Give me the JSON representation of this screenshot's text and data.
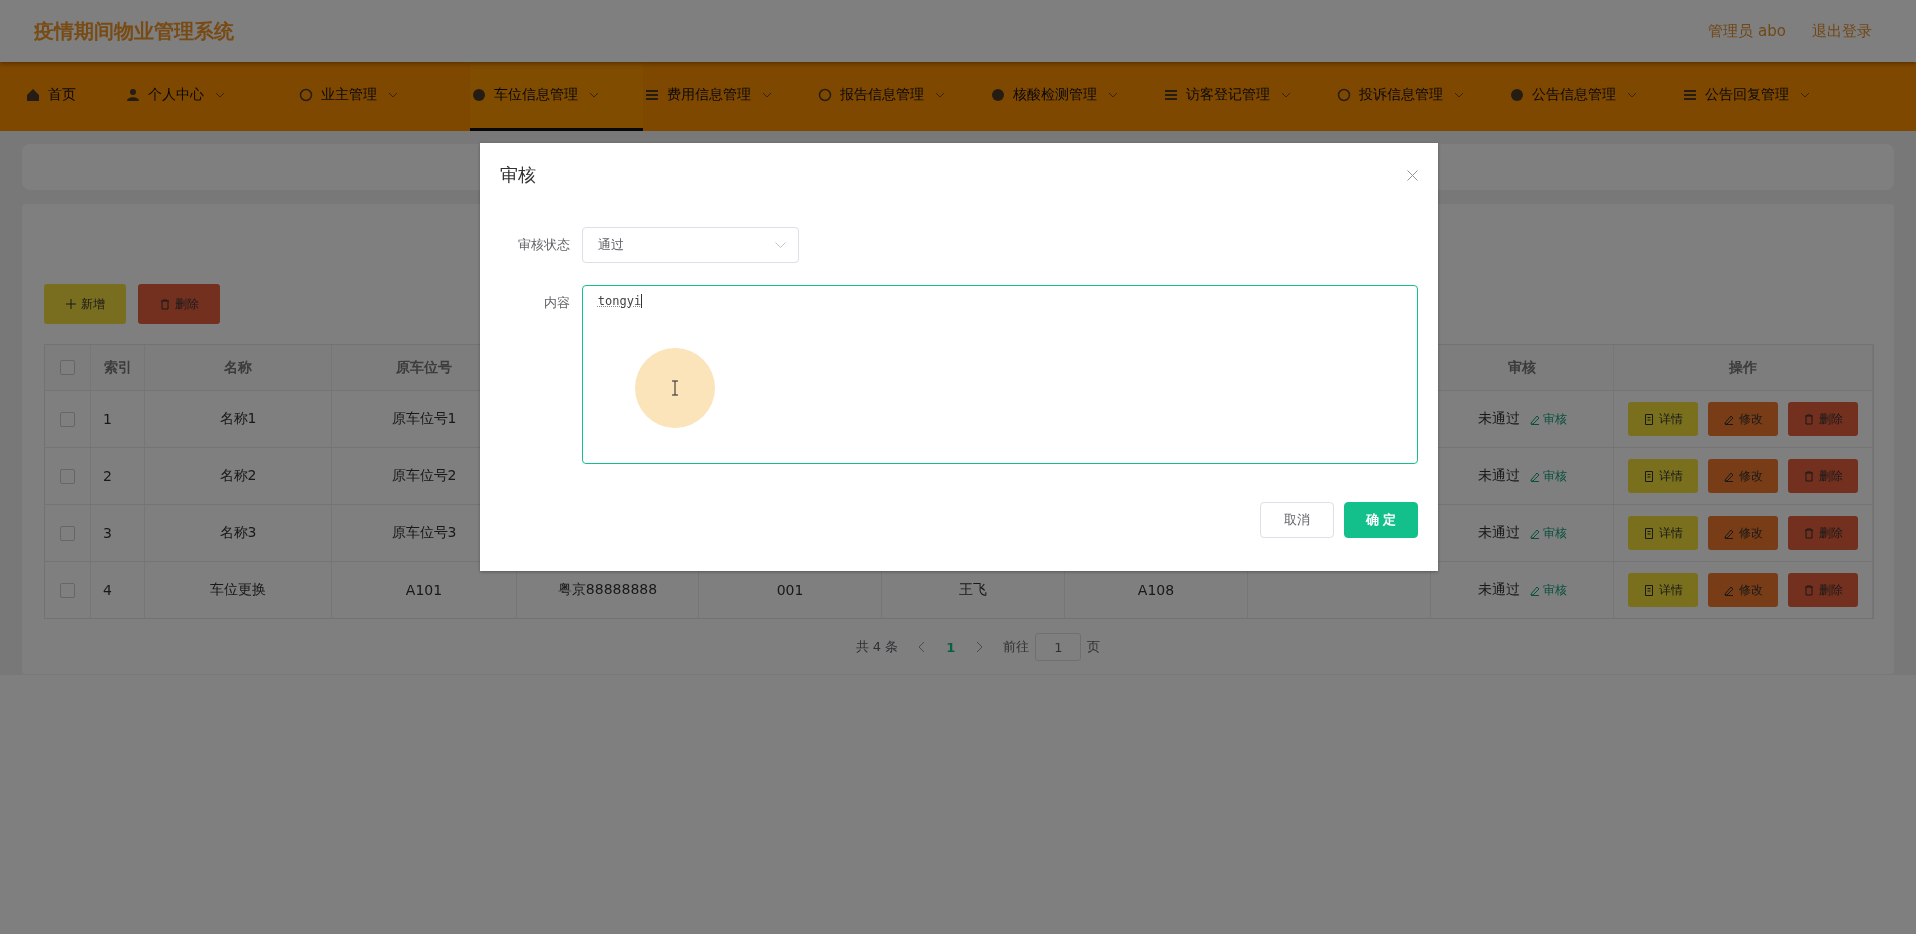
{
  "header": {
    "title": "疫情期间物业管理系统",
    "user": "管理员 abo",
    "logout": "退出登录"
  },
  "nav": [
    {
      "label": "首页",
      "selected": false,
      "dropdown": false
    },
    {
      "label": "个人中心",
      "selected": false,
      "dropdown": true
    },
    {
      "label": "业主管理",
      "selected": false,
      "dropdown": true
    },
    {
      "label": "车位信息管理",
      "selected": true,
      "dropdown": true
    },
    {
      "label": "费用信息管理",
      "selected": false,
      "dropdown": true
    },
    {
      "label": "报告信息管理",
      "selected": false,
      "dropdown": true
    },
    {
      "label": "核酸检测管理",
      "selected": false,
      "dropdown": true
    },
    {
      "label": "访客登记管理",
      "selected": false,
      "dropdown": true
    },
    {
      "label": "投诉信息管理",
      "selected": false,
      "dropdown": true
    },
    {
      "label": "公告信息管理",
      "selected": false,
      "dropdown": true
    },
    {
      "label": "公告回复管理",
      "selected": false,
      "dropdown": true
    }
  ],
  "toolbar": {
    "add": "新增",
    "delete": "删除"
  },
  "table": {
    "all_checked": false,
    "columns": [
      "索引",
      "名称",
      "原车位号",
      "",
      "",
      "",
      "",
      "",
      "审核",
      "操作"
    ],
    "rows": [
      {
        "cells": [
          "1",
          "名称1",
          "原车位号1",
          "",
          "",
          "",
          "",
          ""
        ],
        "checked": false,
        "status": "未通过",
        "review": "审核",
        "actions": [
          "详情",
          "修改",
          "删除"
        ]
      },
      {
        "cells": [
          "2",
          "名称2",
          "原车位号2",
          "",
          "",
          "",
          "",
          ""
        ],
        "checked": false,
        "status": "未通过",
        "review": "审核",
        "actions": [
          "详情",
          "修改",
          "删除"
        ]
      },
      {
        "cells": [
          "3",
          "名称3",
          "原车位号3",
          "",
          "",
          "",
          "",
          ""
        ],
        "checked": false,
        "status": "未通过",
        "review": "审核",
        "actions": [
          "详情",
          "修改",
          "删除"
        ]
      },
      {
        "cells": [
          "4",
          "车位更换",
          "A101",
          "粤京88888888",
          "001",
          "王飞",
          "A108",
          ""
        ],
        "checked": false,
        "status": "未通过",
        "review": "审核",
        "actions": [
          "详情",
          "修改",
          "删除"
        ]
      }
    ]
  },
  "pagination": {
    "total": "共 4 条",
    "pages": [
      {
        "label": "1",
        "selected": true
      }
    ],
    "goto": "前往",
    "page_input": "1",
    "page_unit": "页"
  },
  "dialog": {
    "title": "审核",
    "fields": [
      {
        "kind": "select",
        "label": "审核状态",
        "value": "通过"
      },
      {
        "kind": "textarea",
        "label": "内容",
        "value": "tongyi"
      }
    ],
    "cancel": "取消",
    "confirm": "确 定"
  }
}
